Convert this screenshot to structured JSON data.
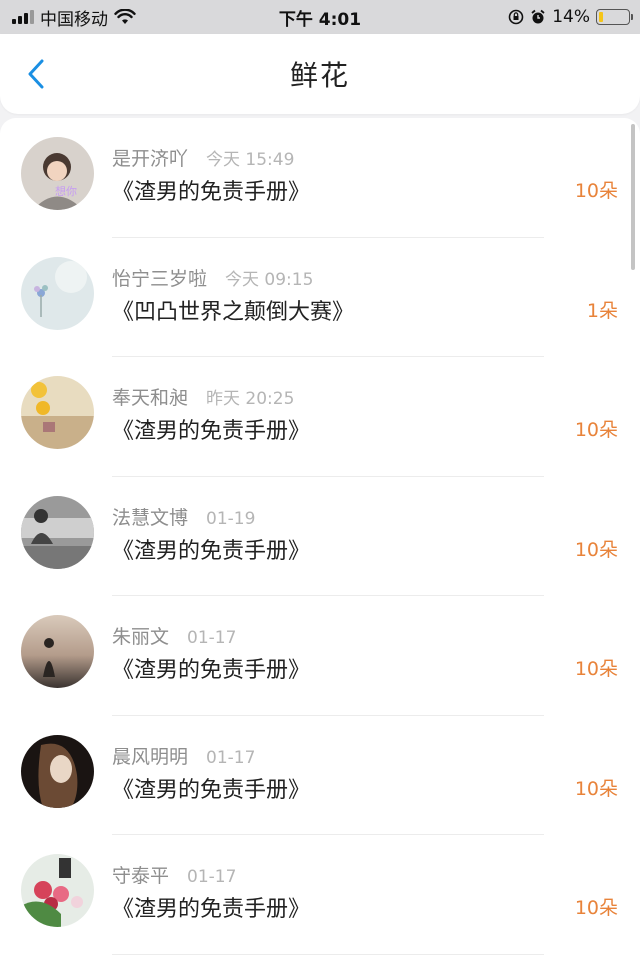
{
  "status": {
    "carrier": "中国移动",
    "time": "下午 4:01",
    "battery": "14%",
    "battery_level": 0.14
  },
  "nav": {
    "title": "鲜花"
  },
  "items": [
    {
      "name": "是开济吖",
      "time": "今天 15:49",
      "book": "《渣男的免责手册》",
      "count": "10朵"
    },
    {
      "name": "怡宁三岁啦",
      "time": "今天 09:15",
      "book": "《凹凸世界之颠倒大赛》",
      "count": "1朵"
    },
    {
      "name": "奉天和昶",
      "time": "昨天 20:25",
      "book": "《渣男的免责手册》",
      "count": "10朵"
    },
    {
      "name": "法慧文博",
      "time": "01-19",
      "book": "《渣男的免责手册》",
      "count": "10朵"
    },
    {
      "name": "朱丽文",
      "time": "01-17",
      "book": "《渣男的免责手册》",
      "count": "10朵"
    },
    {
      "name": "晨风明明",
      "time": "01-17",
      "book": "《渣男的免责手册》",
      "count": "10朵"
    },
    {
      "name": "守泰平",
      "time": "01-17",
      "book": "《渣男的免责手册》",
      "count": "10朵"
    }
  ],
  "colors": {
    "accent": "#1a8fe3",
    "count": "#e8833a"
  }
}
